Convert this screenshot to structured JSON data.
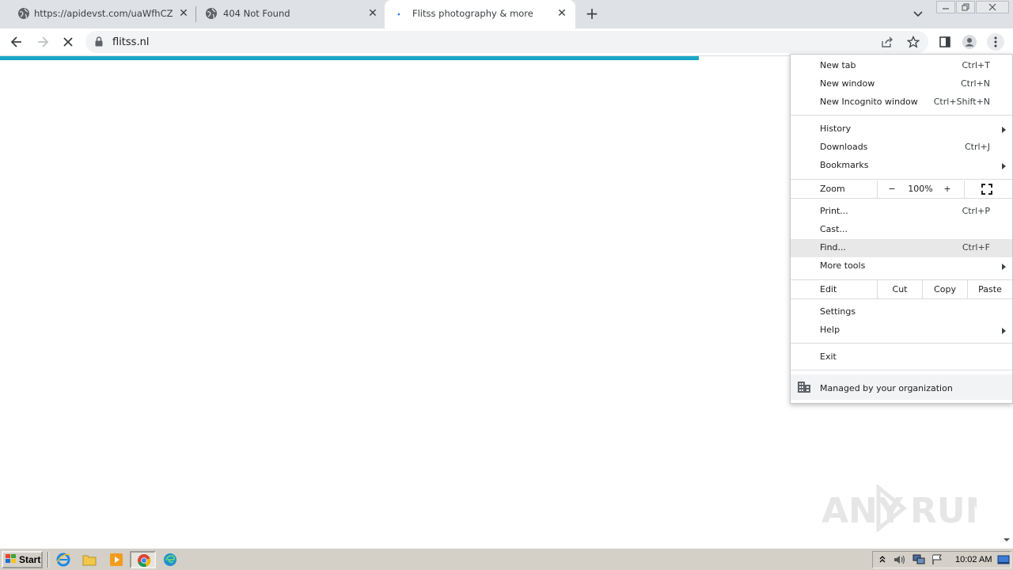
{
  "tabs": [
    {
      "title": "https://apidevst.com/uaWfhCZHOIP"
    },
    {
      "title": "404 Not Found"
    },
    {
      "title": "Flitss photography & more"
    }
  ],
  "address": {
    "url": "flitss.nl"
  },
  "menu": {
    "new_tab": {
      "label": "New tab",
      "shortcut": "Ctrl+T"
    },
    "new_window": {
      "label": "New window",
      "shortcut": "Ctrl+N"
    },
    "incognito": {
      "label": "New Incognito window",
      "shortcut": "Ctrl+Shift+N"
    },
    "history": {
      "label": "History"
    },
    "downloads": {
      "label": "Downloads",
      "shortcut": "Ctrl+J"
    },
    "bookmarks": {
      "label": "Bookmarks"
    },
    "zoom": {
      "label": "Zoom",
      "minus": "−",
      "level": "100%",
      "plus": "+"
    },
    "print": {
      "label": "Print...",
      "shortcut": "Ctrl+P"
    },
    "cast": {
      "label": "Cast..."
    },
    "find": {
      "label": "Find...",
      "shortcut": "Ctrl+F"
    },
    "more_tools": {
      "label": "More tools"
    },
    "edit": {
      "label": "Edit",
      "cut": "Cut",
      "copy": "Copy",
      "paste": "Paste"
    },
    "settings": {
      "label": "Settings"
    },
    "help": {
      "label": "Help"
    },
    "exit": {
      "label": "Exit"
    },
    "managed": {
      "label": "Managed by your organization"
    }
  },
  "page_load_progress": 0.69,
  "watermark": {
    "text_left": "ANY",
    "text_right": "RUN"
  },
  "taskbar": {
    "start": "Start",
    "clock": "10:02 AM"
  },
  "colors": {
    "accent_progress": "#1aa6c8",
    "tabstrip": "#dee1e6",
    "taskbar": "#d4d0c8"
  }
}
